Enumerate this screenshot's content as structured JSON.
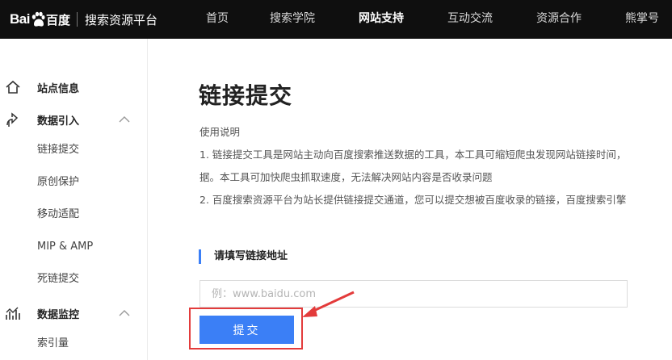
{
  "header": {
    "logo_bai": "Bai",
    "logo_du": "百度",
    "platform": "搜索资源平台",
    "nav": [
      {
        "label": "首页",
        "active": false
      },
      {
        "label": "搜索学院",
        "active": false
      },
      {
        "label": "网站支持",
        "active": true
      },
      {
        "label": "互动交流",
        "active": false
      },
      {
        "label": "资源合作",
        "active": false
      },
      {
        "label": "熊掌号",
        "active": false
      }
    ]
  },
  "sidebar": {
    "groups": [
      {
        "label": "站点信息",
        "icon": "home-icon"
      },
      {
        "label": "数据引入",
        "icon": "data-import-icon",
        "expanded": true,
        "items": [
          "链接提交",
          "原创保护",
          "移动适配",
          "MIP & AMP",
          "死链提交"
        ]
      },
      {
        "label": "数据监控",
        "icon": "data-monitor-icon",
        "expanded": true,
        "items": [
          "索引量"
        ]
      }
    ]
  },
  "main": {
    "title": "链接提交",
    "desc_heading": "使用说明",
    "desc_lines": [
      "1. 链接提交工具是网站主动向百度搜索推送数据的工具，本工具可缩短爬虫发现网站链接时间，",
      "据。本工具可加快爬虫抓取速度，无法解决网站内容是否收录问题",
      "2. 百度搜索资源平台为站长提供链接提交通道，您可以提交想被百度收录的链接，百度搜索引擎"
    ],
    "section_title": "请填写链接地址",
    "url_input": {
      "value": "",
      "placeholder": "例：www.baidu.com"
    },
    "submit_label": "提交"
  },
  "colors": {
    "accent": "#3b7ff6",
    "highlight": "#e33b3b",
    "topbar": "#0f0f0f"
  }
}
